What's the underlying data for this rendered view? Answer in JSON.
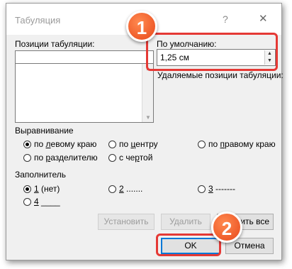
{
  "window": {
    "title": "Табуляция",
    "help": "?",
    "close": "✕"
  },
  "tab_positions": {
    "label": "Позиции табуляции:",
    "value": ""
  },
  "default_tabs": {
    "label": "По умолчанию:",
    "value": "1,25 см"
  },
  "removed_tabs": {
    "label": "Удаляемые позиции табуляции:"
  },
  "alignment": {
    "label": "Выравнивание",
    "options": [
      {
        "label": "по левому краю",
        "selected": true
      },
      {
        "label": "по центру",
        "selected": false
      },
      {
        "label": "по правому краю",
        "selected": false
      },
      {
        "label": "по разделителю",
        "selected": false
      },
      {
        "label": "с чертой",
        "selected": false
      }
    ]
  },
  "leader": {
    "label": "Заполнитель",
    "options": [
      {
        "label": "1 (нет)",
        "selected": true
      },
      {
        "label": "2 .......",
        "selected": false
      },
      {
        "label": "3 -------",
        "selected": false
      },
      {
        "label": "4 ____",
        "selected": false
      }
    ]
  },
  "buttons": {
    "set": "Установить",
    "clear": "Удалить",
    "clear_all": "Удалить все",
    "ok": "OK",
    "cancel": "Отмена"
  },
  "annotations": {
    "step1": "1",
    "step2": "2"
  },
  "colors": {
    "highlight": "#e53935",
    "badge": "#e8481a",
    "focus": "#0078d7"
  }
}
